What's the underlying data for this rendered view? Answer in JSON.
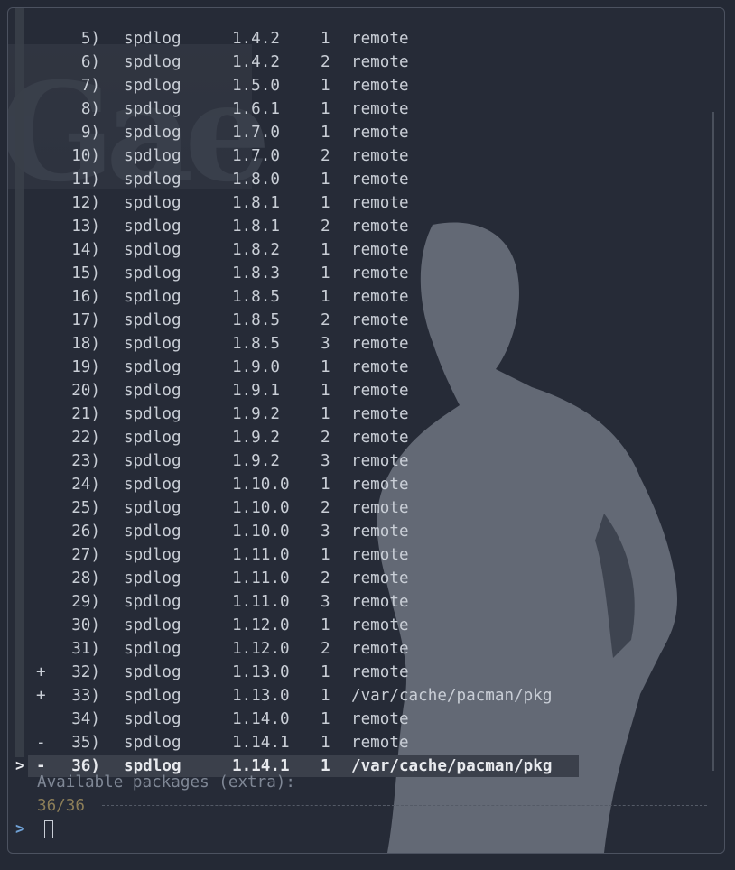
{
  "list": {
    "rows": [
      {
        "mark": "",
        "num": "5)",
        "name": "spdlog",
        "ver": "1.4.2",
        "rel": "1",
        "src": "remote"
      },
      {
        "mark": "",
        "num": "6)",
        "name": "spdlog",
        "ver": "1.4.2",
        "rel": "2",
        "src": "remote"
      },
      {
        "mark": "",
        "num": "7)",
        "name": "spdlog",
        "ver": "1.5.0",
        "rel": "1",
        "src": "remote"
      },
      {
        "mark": "",
        "num": "8)",
        "name": "spdlog",
        "ver": "1.6.1",
        "rel": "1",
        "src": "remote"
      },
      {
        "mark": "",
        "num": "9)",
        "name": "spdlog",
        "ver": "1.7.0",
        "rel": "1",
        "src": "remote"
      },
      {
        "mark": "",
        "num": "10)",
        "name": "spdlog",
        "ver": "1.7.0",
        "rel": "2",
        "src": "remote"
      },
      {
        "mark": "",
        "num": "11)",
        "name": "spdlog",
        "ver": "1.8.0",
        "rel": "1",
        "src": "remote"
      },
      {
        "mark": "",
        "num": "12)",
        "name": "spdlog",
        "ver": "1.8.1",
        "rel": "1",
        "src": "remote"
      },
      {
        "mark": "",
        "num": "13)",
        "name": "spdlog",
        "ver": "1.8.1",
        "rel": "2",
        "src": "remote"
      },
      {
        "mark": "",
        "num": "14)",
        "name": "spdlog",
        "ver": "1.8.2",
        "rel": "1",
        "src": "remote"
      },
      {
        "mark": "",
        "num": "15)",
        "name": "spdlog",
        "ver": "1.8.3",
        "rel": "1",
        "src": "remote"
      },
      {
        "mark": "",
        "num": "16)",
        "name": "spdlog",
        "ver": "1.8.5",
        "rel": "1",
        "src": "remote"
      },
      {
        "mark": "",
        "num": "17)",
        "name": "spdlog",
        "ver": "1.8.5",
        "rel": "2",
        "src": "remote"
      },
      {
        "mark": "",
        "num": "18)",
        "name": "spdlog",
        "ver": "1.8.5",
        "rel": "3",
        "src": "remote"
      },
      {
        "mark": "",
        "num": "19)",
        "name": "spdlog",
        "ver": "1.9.0",
        "rel": "1",
        "src": "remote"
      },
      {
        "mark": "",
        "num": "20)",
        "name": "spdlog",
        "ver": "1.9.1",
        "rel": "1",
        "src": "remote"
      },
      {
        "mark": "",
        "num": "21)",
        "name": "spdlog",
        "ver": "1.9.2",
        "rel": "1",
        "src": "remote"
      },
      {
        "mark": "",
        "num": "22)",
        "name": "spdlog",
        "ver": "1.9.2",
        "rel": "2",
        "src": "remote"
      },
      {
        "mark": "",
        "num": "23)",
        "name": "spdlog",
        "ver": "1.9.2",
        "rel": "3",
        "src": "remote"
      },
      {
        "mark": "",
        "num": "24)",
        "name": "spdlog",
        "ver": "1.10.0",
        "rel": "1",
        "src": "remote"
      },
      {
        "mark": "",
        "num": "25)",
        "name": "spdlog",
        "ver": "1.10.0",
        "rel": "2",
        "src": "remote"
      },
      {
        "mark": "",
        "num": "26)",
        "name": "spdlog",
        "ver": "1.10.0",
        "rel": "3",
        "src": "remote"
      },
      {
        "mark": "",
        "num": "27)",
        "name": "spdlog",
        "ver": "1.11.0",
        "rel": "1",
        "src": "remote"
      },
      {
        "mark": "",
        "num": "28)",
        "name": "spdlog",
        "ver": "1.11.0",
        "rel": "2",
        "src": "remote"
      },
      {
        "mark": "",
        "num": "29)",
        "name": "spdlog",
        "ver": "1.11.0",
        "rel": "3",
        "src": "remote"
      },
      {
        "mark": "",
        "num": "30)",
        "name": "spdlog",
        "ver": "1.12.0",
        "rel": "1",
        "src": "remote"
      },
      {
        "mark": "",
        "num": "31)",
        "name": "spdlog",
        "ver": "1.12.0",
        "rel": "2",
        "src": "remote"
      },
      {
        "mark": "+",
        "num": "32)",
        "name": "spdlog",
        "ver": "1.13.0",
        "rel": "1",
        "src": "remote"
      },
      {
        "mark": "+",
        "num": "33)",
        "name": "spdlog",
        "ver": "1.13.0",
        "rel": "1",
        "src": "/var/cache/pacman/pkg"
      },
      {
        "mark": "",
        "num": "34)",
        "name": "spdlog",
        "ver": "1.14.0",
        "rel": "1",
        "src": "remote"
      },
      {
        "mark": "-",
        "num": "35)",
        "name": "spdlog",
        "ver": "1.14.1",
        "rel": "1",
        "src": "remote"
      },
      {
        "mark": "-",
        "num": "36)",
        "name": "spdlog",
        "ver": "1.14.1",
        "rel": "1",
        "src": "/var/cache/pacman/pkg",
        "selected": true
      }
    ],
    "pointer": ">"
  },
  "header": "Available packages (extra):",
  "counter": "36/36",
  "prompt": {
    "symbol": ">",
    "value": ""
  },
  "colors": {
    "background": "#262b37",
    "pointer": "#d23c68",
    "prompt": "#6fa0d4",
    "counter": "#8c7e58",
    "header": "#7f8795"
  }
}
